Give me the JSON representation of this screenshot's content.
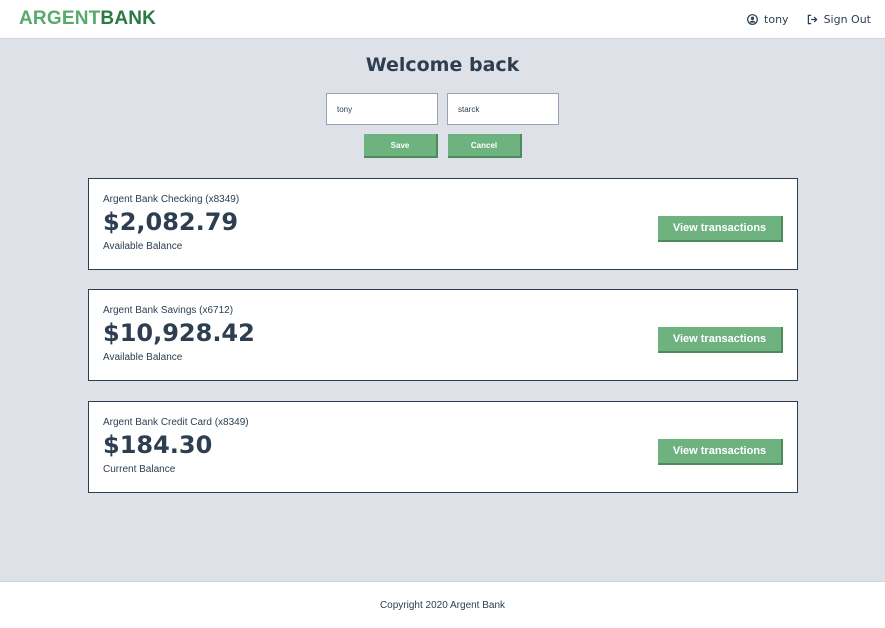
{
  "header": {
    "logo_part1": "ARGENT",
    "logo_part2": "BANK",
    "user_label": "tony",
    "signout_label": "Sign Out",
    "user_icon": "user-circle-icon",
    "signout_icon": "sign-out-icon"
  },
  "main": {
    "welcome_title": "Welcome back",
    "edit_form": {
      "first_name_value": "tony",
      "last_name_value": "starck",
      "save_label": "Save",
      "cancel_label": "Cancel"
    },
    "accounts": [
      {
        "title": "Argent Bank Checking (x8349)",
        "amount": "$2,082.79",
        "description": "Available Balance",
        "button_label": "View transactions"
      },
      {
        "title": "Argent Bank Savings (x6712)",
        "amount": "$10,928.42",
        "description": "Available Balance",
        "button_label": "View transactions"
      },
      {
        "title": "Argent Bank Credit Card (x8349)",
        "amount": "$184.30",
        "description": "Current Balance",
        "button_label": "View transactions"
      }
    ]
  },
  "footer": {
    "copyright": "Copyright 2020 Argent Bank"
  },
  "colors": {
    "brand_green": "#58a96b",
    "brand_dark_green": "#2b7a45",
    "button_green": "#6eb37f",
    "page_background": "#dfe1e9",
    "text": "#2c3e50"
  }
}
